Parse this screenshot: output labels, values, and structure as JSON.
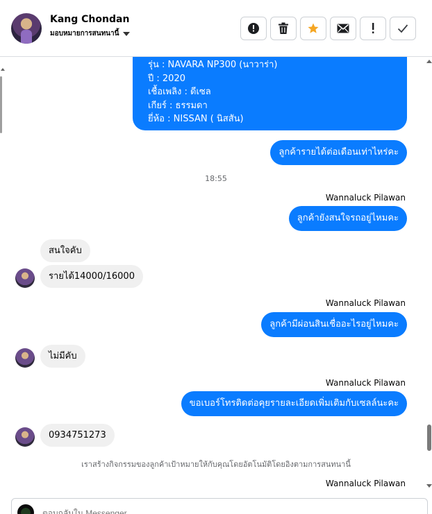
{
  "header": {
    "contact_name": "Kang Chondan",
    "assign_label": "มอบหมายการสนทนานี้",
    "actions": [
      {
        "icon": "exclamation-circle-icon"
      },
      {
        "icon": "trash-icon"
      },
      {
        "icon": "star-icon",
        "color": "#f5a623"
      },
      {
        "icon": "envelope-icon"
      },
      {
        "icon": "exclamation-icon"
      },
      {
        "icon": "checkmark-icon"
      }
    ]
  },
  "thread": {
    "car_info": [
      "รุ่น : NAVARA NP300 (นาวาร่า)",
      "ปี : 2020",
      "เชื้อเพลิง : ดีเซล",
      "เกียร์ : ธรรมดา",
      "ยี่ห้อ : NISSAN ( นิสสัน)"
    ],
    "msg_income_question": "ลูกค้ารายได้ต่อเดือนเท่าไหร่คะ",
    "timestamp": "18:55",
    "sender_1": "Wannaluck Pilawan",
    "msg_still_interested": "ลูกค้ายังสนใจรถอยู่ไหมคะ",
    "reply_interested": "สนใจคับ",
    "reply_income": "รายได้14000/16000",
    "sender_2": "Wannaluck Pilawan",
    "msg_installments": "ลูกค้ามีผ่อนสินเชื่ออะไรอยู่ไหมคะ",
    "reply_none": "ไม่มีคับ",
    "sender_3": "Wannaluck Pilawan",
    "msg_phone_request": "ขอเบอร์โทรติดต่อคุยรายละเอียดเพิ่มเติมกับเซลล์นะคะ",
    "reply_phone": "0934751273",
    "system_notice": "เราสร้างกิจกรรมของลูกค้าเป้าหมายให้กับคุณโดยอัตโนมัติโดยอิงตามการสนทนานี้",
    "sender_4": "Wannaluck Pilawan"
  },
  "composer": {
    "placeholder": "ตอบกลับใน Messenger..."
  },
  "colors": {
    "outgoing_bubble": "#0a7cff",
    "incoming_bubble": "#f0f0f0",
    "star_accent": "#f5a623"
  }
}
